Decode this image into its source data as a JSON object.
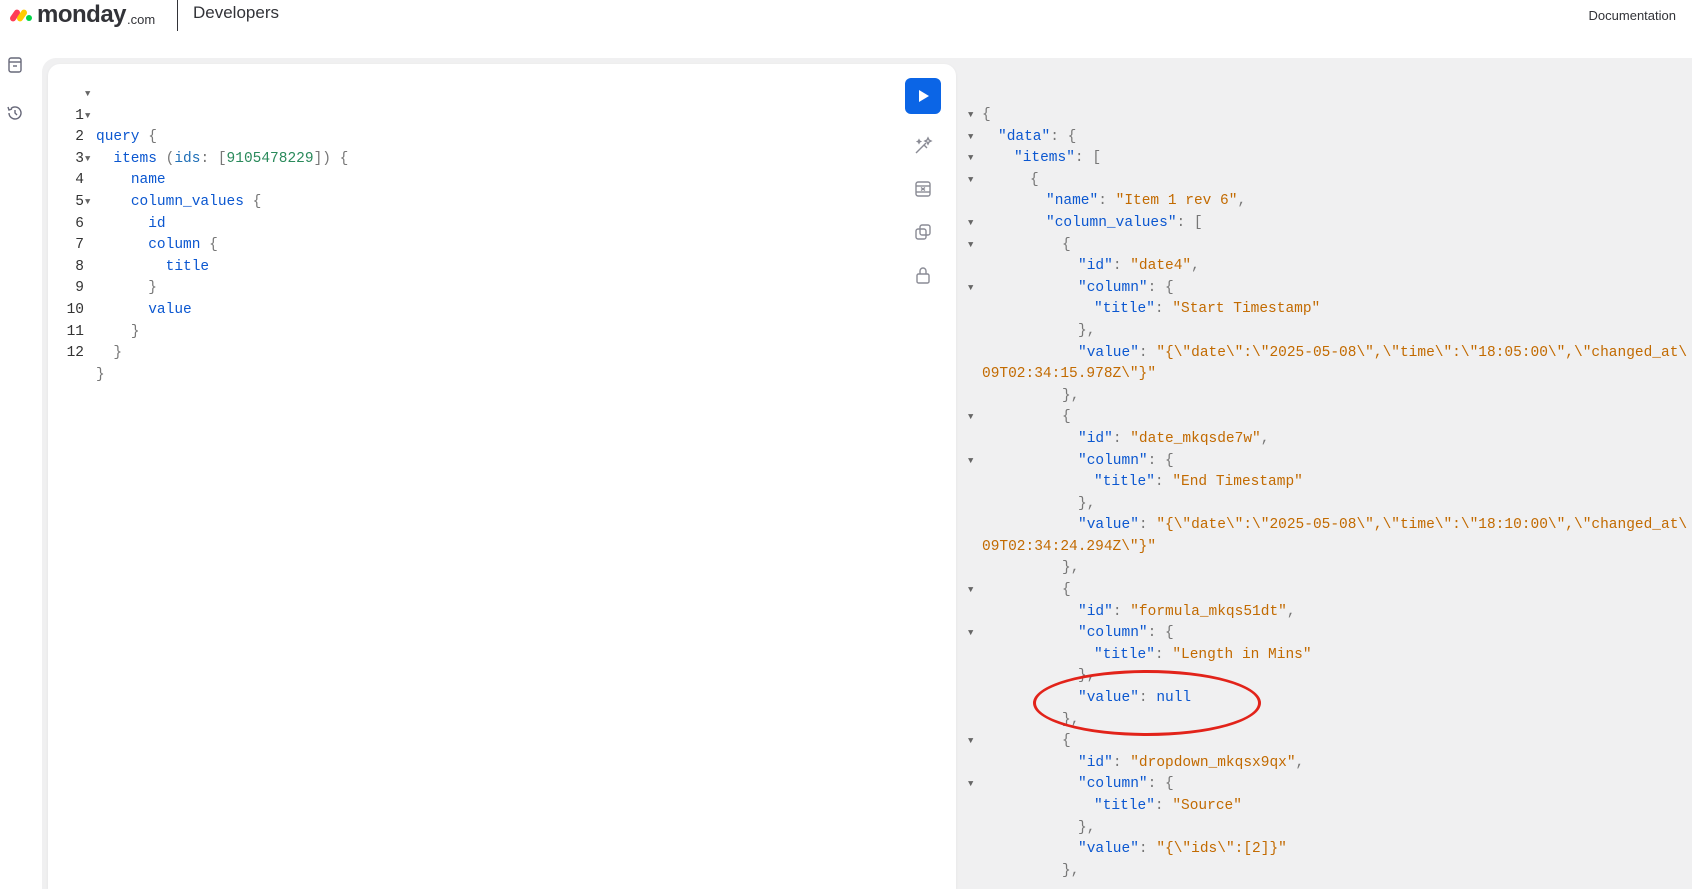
{
  "header": {
    "brand": "monday",
    "brand_suffix": ".com",
    "section": "Developers",
    "documentation_link": "Documentation",
    "logo_colors": [
      "#ff3d57",
      "#ffcb00",
      "#00d647"
    ]
  },
  "sidebar": {
    "items": [
      {
        "icon": "saved-queries-icon"
      },
      {
        "icon": "history-icon"
      }
    ]
  },
  "editor": {
    "lines": [
      {
        "num": "1",
        "fold": true
      },
      {
        "num": "2",
        "fold": true
      },
      {
        "num": "3",
        "fold": false
      },
      {
        "num": "4",
        "fold": true
      },
      {
        "num": "5",
        "fold": false
      },
      {
        "num": "6",
        "fold": true
      },
      {
        "num": "7",
        "fold": false
      },
      {
        "num": "8",
        "fold": false
      },
      {
        "num": "9",
        "fold": false
      },
      {
        "num": "10",
        "fold": false
      },
      {
        "num": "11",
        "fold": false
      },
      {
        "num": "12",
        "fold": false
      }
    ],
    "code": {
      "l1_keyword": "query",
      "l1_brace": " {",
      "l2_field": "items",
      "l2_open": " (",
      "l2_arg": "ids",
      "l2_colon": ": [",
      "l2_value": "9105478229",
      "l2_close": "]) {",
      "l3": "name",
      "l4_field": "column_values",
      "l4_brace": " {",
      "l5": "id",
      "l6_field": "column",
      "l6_brace": " {",
      "l7": "title",
      "l8": "}",
      "l9": "value",
      "l10": "}",
      "l11": "}",
      "l12": "}"
    },
    "toolbar": {
      "run_icon": "play-icon",
      "prettify_icon": "magic-wand-icon",
      "merge_icon": "merge-fragments-icon",
      "copy_icon": "copy-icon",
      "lock_icon": "lock-icon"
    },
    "accent_color": "#0b65e6"
  },
  "result": {
    "r1": "{",
    "r2_key": "\"data\"",
    "r2_rest": ": {",
    "r3_key": "\"items\"",
    "r3_rest": ": [",
    "r4": "{",
    "r5_key": "\"name\"",
    "r5_sep": ": ",
    "r5_val": "\"Item 1 rev 6\"",
    "r5_end": ",",
    "r6_key": "\"column_values\"",
    "r6_rest": ": [",
    "r7": "{",
    "r8_key": "\"id\"",
    "r8_val": "\"date4\"",
    "r9_key": "\"column\"",
    "r10_key": "\"title\"",
    "r10_val": "\"Start Timestamp\"",
    "r11": "},",
    "r12_key": "\"value\"",
    "r12_val": "\"{\\\"date\\\":\\\"2025-05-08\\\",\\\"time\\\":\\\"18:05:00\\\",\\\"changed_at\\",
    "r13_val": "09T02:34:15.978Z\\\"}\"",
    "r14": "},",
    "r15": "{",
    "r16_key": "\"id\"",
    "r16_val": "\"date_mkqsde7w\"",
    "r17_key": "\"column\"",
    "r18_key": "\"title\"",
    "r18_val": "\"End Timestamp\"",
    "r19": "},",
    "r20_key": "\"value\"",
    "r20_val": "\"{\\\"date\\\":\\\"2025-05-08\\\",\\\"time\\\":\\\"18:10:00\\\",\\\"changed_at\\",
    "r21_val": "09T02:34:24.294Z\\\"}\"",
    "r22": "},",
    "r23": "{",
    "r24_key": "\"id\"",
    "r24_val": "\"formula_mkqs51dt\"",
    "r25_key": "\"column\"",
    "r26_key": "\"title\"",
    "r26_val": "\"Length in Mins\"",
    "r27": "},",
    "r28_key": "\"value\"",
    "r28_val": "null",
    "r29": "},",
    "r30": "{",
    "r31_key": "\"id\"",
    "r31_val": "\"dropdown_mkqsx9qx\"",
    "r32_key": "\"column\"",
    "r33_key": "\"title\"",
    "r33_val": "\"Source\"",
    "r34": "},",
    "r35_key": "\"value\"",
    "r35_val": "\"{\\\"ids\\\":[2]}\"",
    "r36": "},"
  },
  "annotation": {
    "highlight_color": "#e2231a"
  }
}
